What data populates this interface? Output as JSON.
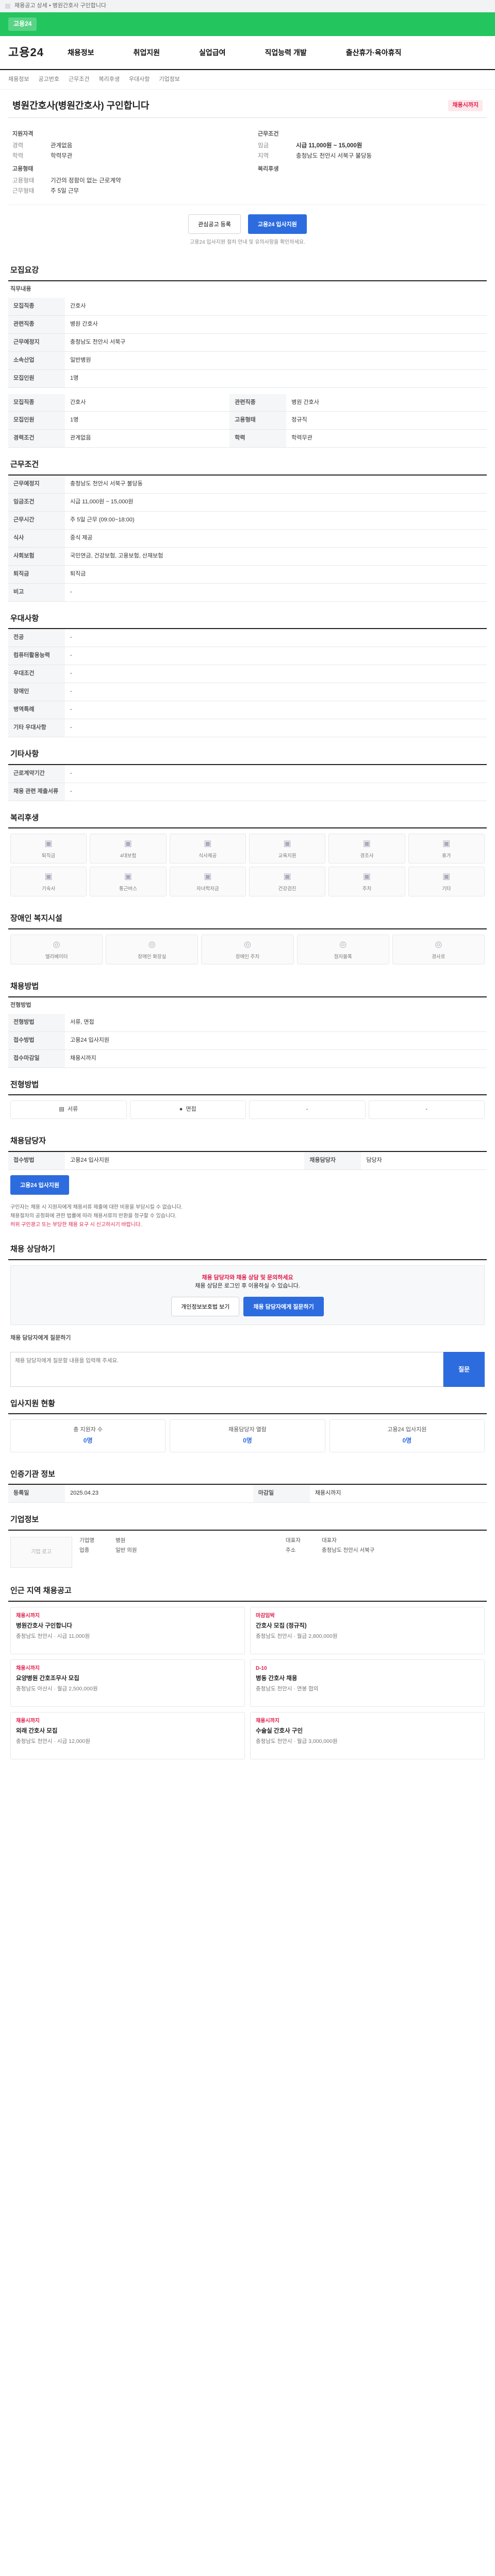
{
  "topbar": {
    "text": "채용공고 상세 • 병원간호사 구인합니다"
  },
  "greenbar": {
    "label": "고용24"
  },
  "header": {
    "logo": "고용24",
    "nav": [
      "채용정보",
      "취업지원",
      "실업급여",
      "직업능력 개발",
      "출산휴가·육아휴직"
    ]
  },
  "crumbs": [
    "채용정보",
    "공고번호",
    "근무조건",
    "복리후생",
    "우대사항",
    "기업정보"
  ],
  "title": {
    "text": "병원간호사(병원간호사) 구인합니다",
    "badge": "채용시까지"
  },
  "summary": {
    "left_title": "지원자격",
    "left_rows": [
      {
        "k": "경력",
        "v": "관계없음"
      },
      {
        "k": "학력",
        "v": "학력무관"
      }
    ],
    "left2_title": "고용형태",
    "left2_rows": [
      {
        "k": "고용형태",
        "v": "기간의 정함이 없는 근로계약"
      },
      {
        "k": "근무형태",
        "v": "주 5일 근무"
      }
    ],
    "right_title": "근무조건",
    "right_rows": [
      {
        "k": "임금",
        "v": "시급 11,000원 ~ 15,000원"
      },
      {
        "k": "지역",
        "v": "충청남도 천안시 서북구 불당동"
      }
    ],
    "right2_title": "복리후생",
    "right2_rows": [
      {
        "k": "",
        "v": ""
      }
    ]
  },
  "apply": {
    "save": "관심공고 등록",
    "apply": "고용24 입사지원",
    "note": "고용24 입사지원 절차 안내 및 유의사항을 확인하세요."
  },
  "recruit": {
    "title": "모집요강",
    "sub": "직무내용",
    "rows": [
      {
        "k": "모집직종",
        "v": "간호사"
      },
      {
        "k": "관련직종",
        "v": "병원 간호사"
      },
      {
        "k": "근무예정지",
        "v": "충청남도 천안시 서북구"
      },
      {
        "k": "소속산업",
        "v": "일반병원"
      },
      {
        "k": "모집인원",
        "v": "1명"
      }
    ],
    "grid": [
      {
        "k": "모집직종",
        "v": "간호사",
        "k2": "관련직종",
        "v2": "병원 간호사"
      },
      {
        "k": "모집인원",
        "v": "1명",
        "k2": "고용형태",
        "v2": "정규직"
      },
      {
        "k": "경력조건",
        "v": "관계없음",
        "k2": "학력",
        "v2": "학력무관"
      }
    ]
  },
  "conditions": {
    "title": "근무조건",
    "rows": [
      {
        "k": "근무예정지",
        "v": "충청남도 천안시 서북구 불당동"
      },
      {
        "k": "임금조건",
        "v": "시급 11,000원 ~ 15,000원"
      },
      {
        "k": "근무시간",
        "v": "주 5일 근무 (09:00~18:00)"
      },
      {
        "k": "식사",
        "v": "중식 제공"
      },
      {
        "k": "사회보험",
        "v": "국민연금, 건강보험, 고용보험, 산재보험"
      },
      {
        "k": "퇴직금",
        "v": "퇴직금"
      },
      {
        "k": "비고",
        "v": "-"
      }
    ]
  },
  "prefer": {
    "title": "우대사항",
    "rows": [
      {
        "k": "전공",
        "v": "-"
      },
      {
        "k": "컴퓨터활용능력",
        "v": "-"
      },
      {
        "k": "우대조건",
        "v": "-"
      },
      {
        "k": "장애인",
        "v": "-"
      },
      {
        "k": "병역특례",
        "v": "-"
      },
      {
        "k": "기타 우대사항",
        "v": "-"
      }
    ]
  },
  "other": {
    "title": "기타사항",
    "rows": [
      {
        "k": "근로계약기간",
        "v": "-"
      },
      {
        "k": "채용 관련 제출서류",
        "v": "-"
      }
    ]
  },
  "welfare": {
    "title": "복리후생",
    "cards": [
      "퇴직금",
      "4대보험",
      "식사제공",
      "교육지원",
      "경조사",
      "휴가",
      "기숙사",
      "통근버스",
      "자녀학자금",
      "건강검진",
      "주차",
      "기타"
    ]
  },
  "disabled": {
    "title": "장애인 복지시설",
    "cards": [
      "엘리베이터",
      "장애인 화장실",
      "장애인 주차",
      "점자블록",
      "경사로"
    ]
  },
  "apply_method": {
    "title": "채용방법",
    "sub": "전형방법",
    "rows": [
      {
        "k": "전형방법",
        "v": "서류, 면접"
      },
      {
        "k": "접수방법",
        "v": "고용24 입사지원"
      },
      {
        "k": "접수마감일",
        "v": "채용시까지"
      }
    ]
  },
  "step": {
    "title": "전형방법",
    "tabs": [
      "서류",
      "면접",
      "-",
      "-"
    ]
  },
  "contact": {
    "title": "채용담당자",
    "k1": "접수방법",
    "v1": "고용24 입사지원",
    "k2": "채용담당자",
    "v2": "담당자",
    "apply_btn": "고용24 입사지원",
    "notes": [
      "구인자는 채용 시 지원자에게 채용서류 제출에 대한 비용을 부담시킬 수 없습니다.",
      "채용절차의 공정화에 관한 법률에 따라 채용서류의 반환을 청구할 수 있습니다.",
      "허위 구인광고 또는 부당한 채용 요구 시 신고하시기 바랍니다."
    ]
  },
  "consult": {
    "title": "채용 상담하기",
    "red": "채용 담당자와 채용 상담 및 문의하세요",
    "desc": "채용 상담은 로그인 후 이용하실 수 있습니다.",
    "b1": "개인정보보호법 보기",
    "b2": "채용 담당자에게 질문하기"
  },
  "question": {
    "title": "채용 담당자에게 질문하기",
    "placeholder": "채용 담당자에게 질문할 내용을 입력해 주세요.",
    "btn": "질문"
  },
  "hist": {
    "title": "입사지원 현황",
    "stats": [
      {
        "k": "총 지원자 수",
        "v": "0명"
      },
      {
        "k": "채용담당자 열람",
        "v": "0명"
      },
      {
        "k": "고용24 입사지원",
        "v": "0명"
      }
    ]
  },
  "info": {
    "title": "인증기관 정보",
    "rows": [
      {
        "k": "등록일",
        "v": "2025.04.23"
      },
      {
        "k": "마감일",
        "v": "채용시까지"
      }
    ]
  },
  "company": {
    "title": "기업정보",
    "logo": "기업 로고",
    "name": "병원",
    "rows": [
      {
        "k": "기업명",
        "v": "병원"
      },
      {
        "k": "업종",
        "v": "일반 의원"
      },
      {
        "k": "대표자",
        "v": "대표자"
      },
      {
        "k": "주소",
        "v": "충청남도 천안시 서북구"
      }
    ]
  },
  "jobs": {
    "title": "인근 지역 채용공고",
    "items": [
      {
        "tag": "채용시까지",
        "t": "병원간호사 구인합니다",
        "m": "충청남도 천안시 · 시급 11,000원"
      },
      {
        "tag": "마감임박",
        "t": "간호사 모집 (정규직)",
        "m": "충청남도 천안시 · 월급 2,800,000원"
      },
      {
        "tag": "채용시까지",
        "t": "요양병원 간호조무사 모집",
        "m": "충청남도 아산시 · 월급 2,500,000원"
      },
      {
        "tag": "D-10",
        "t": "병동 간호사 채용",
        "m": "충청남도 천안시 · 연봉 협의"
      },
      {
        "tag": "채용시까지",
        "t": "외래 간호사 모집",
        "m": "충청남도 천안시 · 시급 12,000원"
      },
      {
        "tag": "채용시까지",
        "t": "수술실 간호사 구인",
        "m": "충청남도 천안시 · 월급 3,000,000원"
      }
    ]
  }
}
